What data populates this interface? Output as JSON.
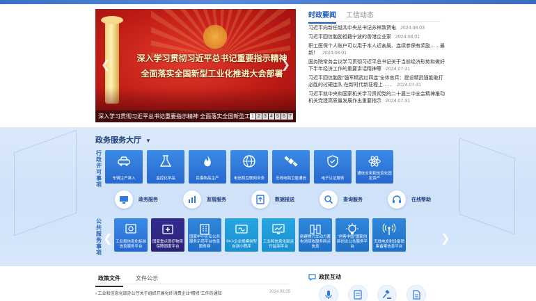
{
  "carousel": {
    "banner_line1": "深入学习贯彻习近平总书记重要指示精神",
    "banner_line2": "全面落实全国新型工业化推进大会部署",
    "caption": "深入学习贯彻习近平总书记重要指示精神  全面落实全国新型工业...",
    "dots": [
      "1",
      "2",
      "3",
      "4",
      "5",
      "6",
      "7"
    ],
    "prev_glyph": "❮",
    "next_glyph": "❯"
  },
  "news": {
    "tabs": [
      "时政要闻",
      "工信动态"
    ],
    "items": [
      {
        "text": "习近平向新任越共中央总书记苏林致贺电",
        "date": "2024.08.03"
      },
      {
        "text": "习近平回信勉励祖籍宁波的香港企业家",
        "date": "2024.08.01"
      },
      {
        "text": "职工医保个人账户可以用于本人近亲属、连续参保有奖励……最新！",
        "date": "2024.08.01"
      },
      {
        "text": "国务院常务会议学习贯彻习近平总书记关于当前经济形势和做好下半年经济工作的重要讲话精神等",
        "date": "2024.07.31"
      },
      {
        "text": "习近平回信勉励“强军精武红四连”全体官兵：建设精武强能敢打必胜的过硬连队 在新时代新征程上……",
        "date": "2024.07.31"
      },
      {
        "text": "习近平就中央和国家机关学习贯彻党的二十届三中全会精神推动机关党建高质量发展作出重要指示",
        "date": "2024.07.31"
      }
    ]
  },
  "hall": {
    "title": "政务服务大厅",
    "caret": "▼",
    "admin_label": "行政许可事项",
    "public_label": "公共服务事项",
    "admin_tiles": [
      {
        "label": "车辆生产准入",
        "icon": "car-icon"
      },
      {
        "label": "监控化学品",
        "icon": "flask-icon"
      },
      {
        "label": "民爆物品生产",
        "icon": "flame-icon"
      },
      {
        "label": "电信和互联网业务",
        "icon": "globe-icon"
      },
      {
        "label": "无线电和卫星通信",
        "icon": "satellite-icon"
      },
      {
        "label": "电子认证服务",
        "icon": "shield-icon"
      },
      {
        "label": "通信业务和信息化固定资产",
        "icon": "atom-icon"
      }
    ],
    "services": [
      {
        "label": "政务服务",
        "icon": "monitor-icon"
      },
      {
        "label": "监管服务",
        "icon": "chart-icon"
      },
      {
        "label": "数据报送",
        "icon": "upload-icon"
      },
      {
        "label": "查询服务",
        "icon": "search-icon"
      },
      {
        "label": "在线帮助",
        "icon": "headset-icon"
      }
    ],
    "public_tiles": [
      {
        "label": "工业和信息化标准信息服务平台",
        "icon": "standard-icon",
        "style": "blue"
      },
      {
        "label": "国家重点医疗物资保障调度平台",
        "icon": "medical-icon",
        "style": "dark"
      },
      {
        "label": "国家中小企业公共服务示范平台信息服务网",
        "icon": "building-icon",
        "style": "blue2"
      },
      {
        "label": "中小企业规模类型自测小程序",
        "icon": "miniapp-icon",
        "style": "cyan"
      },
      {
        "label": "工业和信息化部运行监测平台",
        "icon": "monitor-chart-icon",
        "style": "cyan"
      },
      {
        "label": "新建燃汽车动力蓄电池回收服务网点信息",
        "icon": "battery-icon",
        "style": "blue2"
      },
      {
        "label": "“创客中国”国家创新创业公共服务平台",
        "icon": "bulb-icon",
        "style": "blue2"
      },
      {
        "label": "无线电发射设备销售备案信息平台",
        "icon": "antenna-icon",
        "style": "blue2"
      }
    ],
    "prev_glyph": "❮",
    "next_glyph": "❯"
  },
  "policy": {
    "tabs": [
      "政策文件",
      "文件公示"
    ],
    "items": [
      {
        "text": "工业和信息化部办公厅关于组织开展化纤消费企业“精修”工作的通知",
        "date": "2024.08.05"
      }
    ]
  },
  "interaction": {
    "title": "政民互动",
    "icons": [
      "microphone-icon",
      "survey-icon",
      "gavel-icon",
      "document-icon"
    ]
  },
  "colors": {
    "accent": "#1f5ab8",
    "tile_blue": "#2d78d8",
    "tile_dark": "#2f2784",
    "banner_red": "#c11d17"
  }
}
